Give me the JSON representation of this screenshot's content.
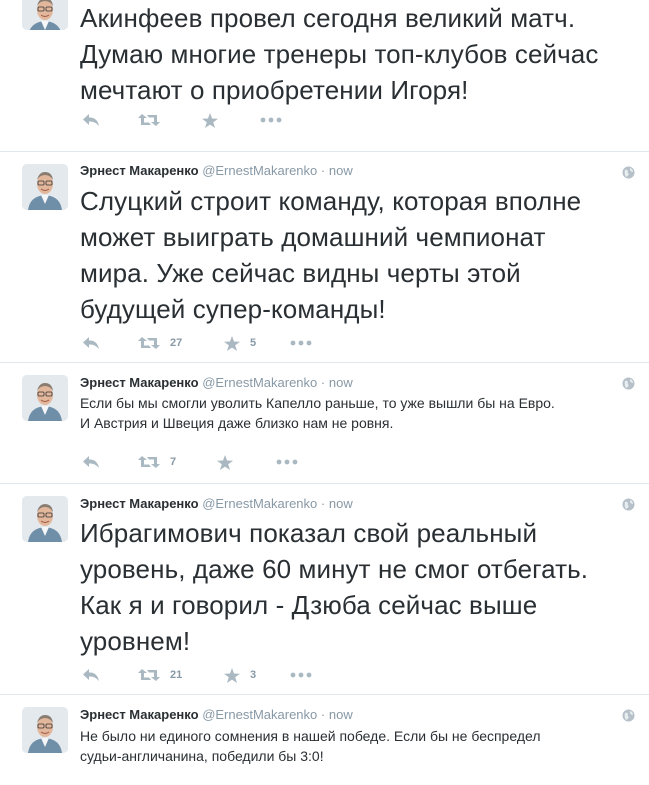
{
  "tweets": [
    {
      "name": "",
      "handle": "",
      "dot": "",
      "time": "",
      "text": "Акинфеев провел сегодня великий матч. Думаю многие тренеры топ-клубов сейчас мечтают о приобретении Игоря!",
      "retweets": "",
      "favorites": ""
    },
    {
      "name": "Эрнест Макаренко",
      "handle": "@ErnestMakarenko",
      "dot": "·",
      "time": "now",
      "text": "Слуцкий строит команду, которая вполне может выиграть домашний чемпионат мира. Уже сейчас видны черты этой будущей супер-команды!",
      "retweets": "27",
      "favorites": "5"
    },
    {
      "name": "Эрнест Макаренко",
      "handle": "@ErnestMakarenko",
      "dot": "·",
      "time": "now",
      "text": "Если бы мы смогли уволить Капелло раньше, то уже вышли бы на Евро. И Австрия и Швеция даже близко нам не ровня.",
      "retweets": "7",
      "favorites": ""
    },
    {
      "name": "Эрнест Макаренко",
      "handle": "@ErnestMakarenko",
      "dot": "·",
      "time": "now",
      "text": "Ибрагимович показал свой реальный уровень, даже 60 минут не смог отбегать. Как я и говорил - Дзюба сейчас выше уровнем!",
      "retweets": "21",
      "favorites": "3"
    },
    {
      "name": "Эрнест Макаренко",
      "handle": "@ErnestMakarenko",
      "dot": "·",
      "time": "now",
      "text": "Не было ни единого сомнения в нашей победе. Если бы не беспредел судьи-англичанина, победили бы 3:0!",
      "retweets": "",
      "favorites": ""
    }
  ],
  "icons": {
    "reply": "reply-icon",
    "retweet": "retweet-icon",
    "favorite": "star-icon",
    "more": "more-dots-icon",
    "globe": "globe-icon",
    "avatar": "avatar"
  },
  "colors": {
    "name": "#292f33",
    "meta": "#8899a6",
    "icon": "#aab8c2",
    "divider": "#e1e8ed"
  }
}
